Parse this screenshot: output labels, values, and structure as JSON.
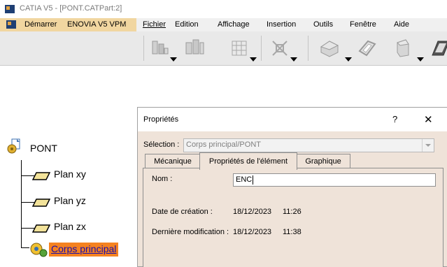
{
  "window": {
    "title": "CATIA V5 - [PONT.CATPart:2]"
  },
  "menu": {
    "start": "Démarrer",
    "enovia": "ENOVIA V5 VPM",
    "file": "Fichier",
    "edit": "Edition",
    "view": "Affichage",
    "insert": "Insertion",
    "tools": "Outils",
    "window": "Fenêtre",
    "help": "Aide"
  },
  "toolbar": {
    "icons": [
      "multi-instantiation-icon",
      "pattern-icon",
      "grid-pattern-icon",
      "symmetry-icon",
      "solid-face-icon",
      "hollow-shape-icon",
      "shell-icon",
      "extrude-icon"
    ]
  },
  "tree": {
    "root": "PONT",
    "items": [
      {
        "label": "Plan xy",
        "icon": "plane-icon"
      },
      {
        "label": "Plan yz",
        "icon": "plane-icon"
      },
      {
        "label": "Plan zx",
        "icon": "plane-icon"
      },
      {
        "label": "Corps principal",
        "icon": "body-gear-icon",
        "selected": true
      }
    ],
    "selection_color": "#f58220"
  },
  "dialog": {
    "title": "Propriétés",
    "help_button": "?",
    "close_button": "✕",
    "selection_label": "Sélection :",
    "selection_value": "Corps principal/PONT",
    "tabs": [
      {
        "label": "Mécanique",
        "active": false
      },
      {
        "label": "Propriétés de l'élément",
        "active": true
      },
      {
        "label": "Graphique",
        "active": false
      }
    ],
    "name_label": "Nom :",
    "name_value": "ENC",
    "created_label": "Date de création :",
    "created_date": "18/12/2023",
    "created_time": "11:26",
    "modified_label": "Dernière modification :",
    "modified_date": "18/12/2023",
    "modified_time": "11:38"
  }
}
